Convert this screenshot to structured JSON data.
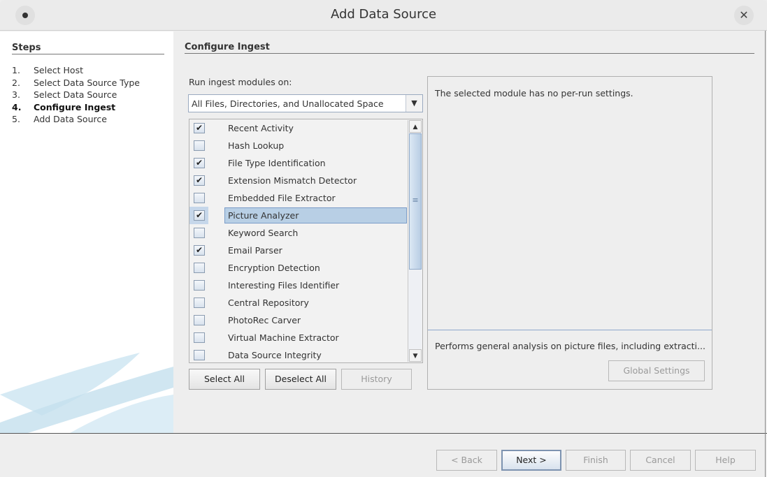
{
  "window": {
    "title": "Add Data Source",
    "menu_icon": "circle-menu",
    "close_icon": "close-x"
  },
  "steps": {
    "heading": "Steps",
    "items": [
      {
        "num": "1.",
        "label": "Select Host",
        "current": false
      },
      {
        "num": "2.",
        "label": "Select Data Source Type",
        "current": false
      },
      {
        "num": "3.",
        "label": "Select Data Source",
        "current": false
      },
      {
        "num": "4.",
        "label": "Configure Ingest",
        "current": true
      },
      {
        "num": "5.",
        "label": "Add Data Source",
        "current": false
      }
    ]
  },
  "main": {
    "heading": "Configure Ingest",
    "run_label": "Run ingest modules on:",
    "run_selected": "All Files, Directories, and Unallocated Space",
    "modules": [
      {
        "label": "Recent Activity",
        "checked": true
      },
      {
        "label": "Hash Lookup",
        "checked": false
      },
      {
        "label": "File Type Identification",
        "checked": true
      },
      {
        "label": "Extension Mismatch Detector",
        "checked": true
      },
      {
        "label": "Embedded File Extractor",
        "checked": false
      },
      {
        "label": "Picture Analyzer",
        "checked": true,
        "selected": true
      },
      {
        "label": "Keyword Search",
        "checked": false
      },
      {
        "label": "Email Parser",
        "checked": true
      },
      {
        "label": "Encryption Detection",
        "checked": false
      },
      {
        "label": "Interesting Files Identifier",
        "checked": false
      },
      {
        "label": "Central Repository",
        "checked": false
      },
      {
        "label": "PhotoRec Carver",
        "checked": false
      },
      {
        "label": "Virtual Machine Extractor",
        "checked": false
      },
      {
        "label": "Data Source Integrity",
        "checked": false
      }
    ],
    "select_all": "Select All",
    "deselect_all": "Deselect All",
    "history": "History",
    "settings_text": "The selected module has no per-run settings.",
    "module_description": "Performs general analysis on picture files, including extracti...",
    "global_settings": "Global Settings"
  },
  "footer": {
    "back": "< Back",
    "next": "Next >",
    "finish": "Finish",
    "cancel": "Cancel",
    "help": "Help"
  },
  "colors": {
    "selection": "#b8cfe5",
    "selection_border": "#7a9cc8",
    "divider": "#8ea7cc"
  }
}
